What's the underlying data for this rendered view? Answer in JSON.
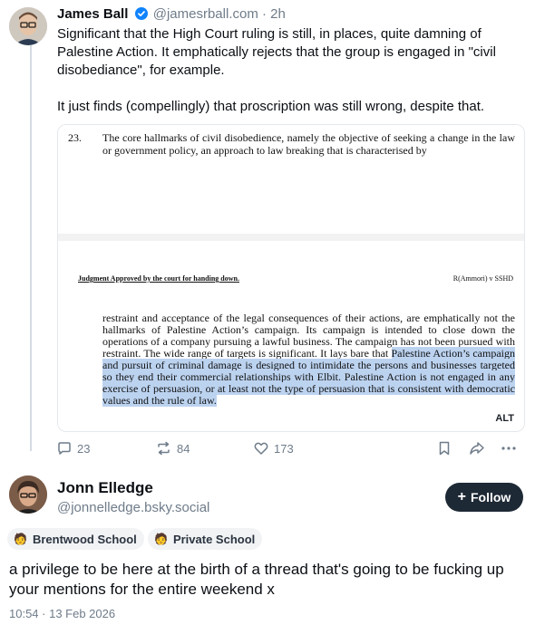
{
  "post1": {
    "author_name": "James Ball",
    "handle": "@jamesrball.com",
    "time": "· 2h",
    "text_p1": "Significant that the High Court ruling is still, in places, quite damning of Palestine Action. It emphatically rejects that the group is engaged in \"civil disobediance\", for example.",
    "text_p2": "It just finds (compellingly) that proscription was still wrong, despite that.",
    "image": {
      "para_number": "23.",
      "para23_text": "The core hallmarks of civil disobedience, namely the objective of seeking a change in the law or government policy, an approach to law breaking that is characterised by",
      "judgment_header": "Judgment Approved by the court for handing down.",
      "case_ref": "R(Ammori) v SSHD",
      "body_plain": "restraint and acceptance of the legal consequences of their actions, are emphatically not the hallmarks of Palestine Action’s campaign. Its campaign is intended to close down the operations of a company pursuing a lawful business. The campaign has not been pursued with restraint. The wide range of targets is significant. It lays bare that ",
      "body_highlight": "Palestine Action’s campaign and pursuit of criminal damage is designed to intimidate the persons and businesses targeted so they end their commercial relationships with Elbit. Palestine Action is not engaged in any exercise of persuasion, or at least not the type of persuasion that is consistent with democratic values and the rule of law.",
      "alt_label": "ALT"
    },
    "actions": {
      "replies": "23",
      "reposts": "84",
      "likes": "173"
    }
  },
  "post2": {
    "author_name": "Jonn Elledge",
    "handle": "@jonnelledge.bsky.social",
    "follow_label": "Follow",
    "badges": [
      "Brentwood School",
      "Private School"
    ],
    "text": "a privilege to be here at the birth of a thread that's going to be fucking up your mentions for the entire weekend x",
    "timestamp": "10:54 · 13 Feb 2026"
  },
  "colors": {
    "accent": "#1083fe",
    "follow_bg": "#1e2936",
    "highlight": "#bcd3f0",
    "muted": "#6f7c8a"
  }
}
